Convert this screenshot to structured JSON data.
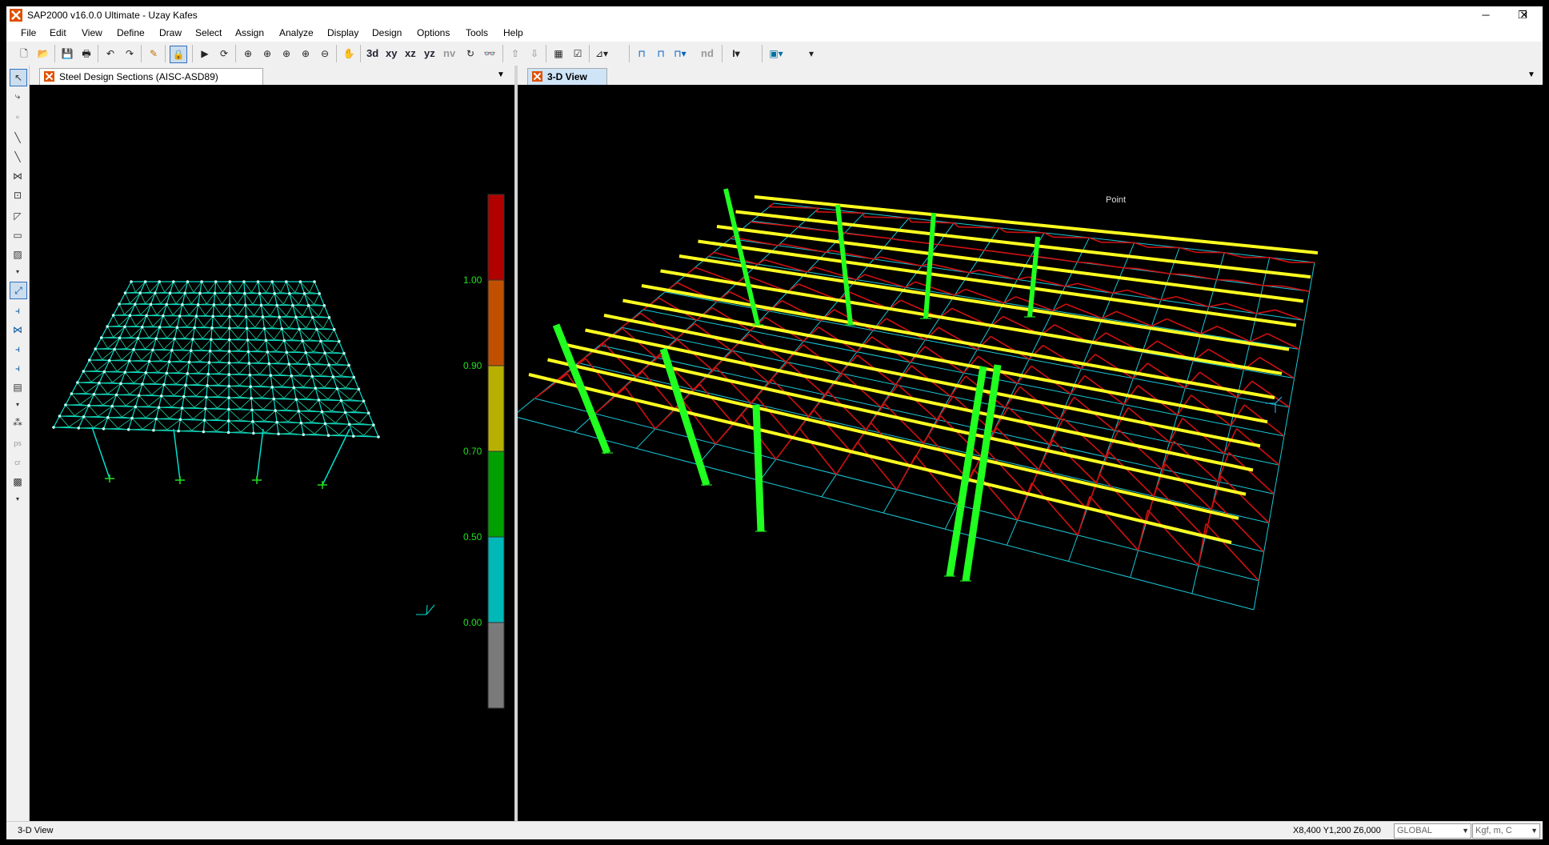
{
  "window": {
    "title": "SAP2000 v16.0.0 Ultimate  - Uzay Kafes",
    "minimize": "─",
    "restore": "❐",
    "close": "✕"
  },
  "menu": [
    "File",
    "Edit",
    "View",
    "Define",
    "Draw",
    "Select",
    "Assign",
    "Analyze",
    "Display",
    "Design",
    "Options",
    "Tools",
    "Help"
  ],
  "toolbar": {
    "xy": "xy",
    "xz": "xz",
    "yz": "yz",
    "nv": "nv",
    "nd": "nd"
  },
  "left_pane": {
    "tab_label": "Steel Design Sections  (AISC-ASD89)",
    "legend": {
      "labels": [
        "1.00",
        "0.90",
        "0.70",
        "0.50",
        "0.00"
      ],
      "colors": [
        "#b00000",
        "#c05000",
        "#b8b000",
        "#00a000",
        "#00b8b8",
        "#7a7a7a"
      ]
    }
  },
  "right_pane": {
    "tab_label": "3-D View",
    "annotation": "Point"
  },
  "status": {
    "view_name": "3-D View",
    "coords": "X8,400  Y1,200  Z6,000",
    "coord_system": "GLOBAL",
    "units": "Kgf, m, C"
  },
  "colors": {
    "mesh": "#00e0d0",
    "truss": "#d01010",
    "purlin": "#ffff20",
    "column": "#20ff20",
    "grid": "#18c8d8"
  }
}
